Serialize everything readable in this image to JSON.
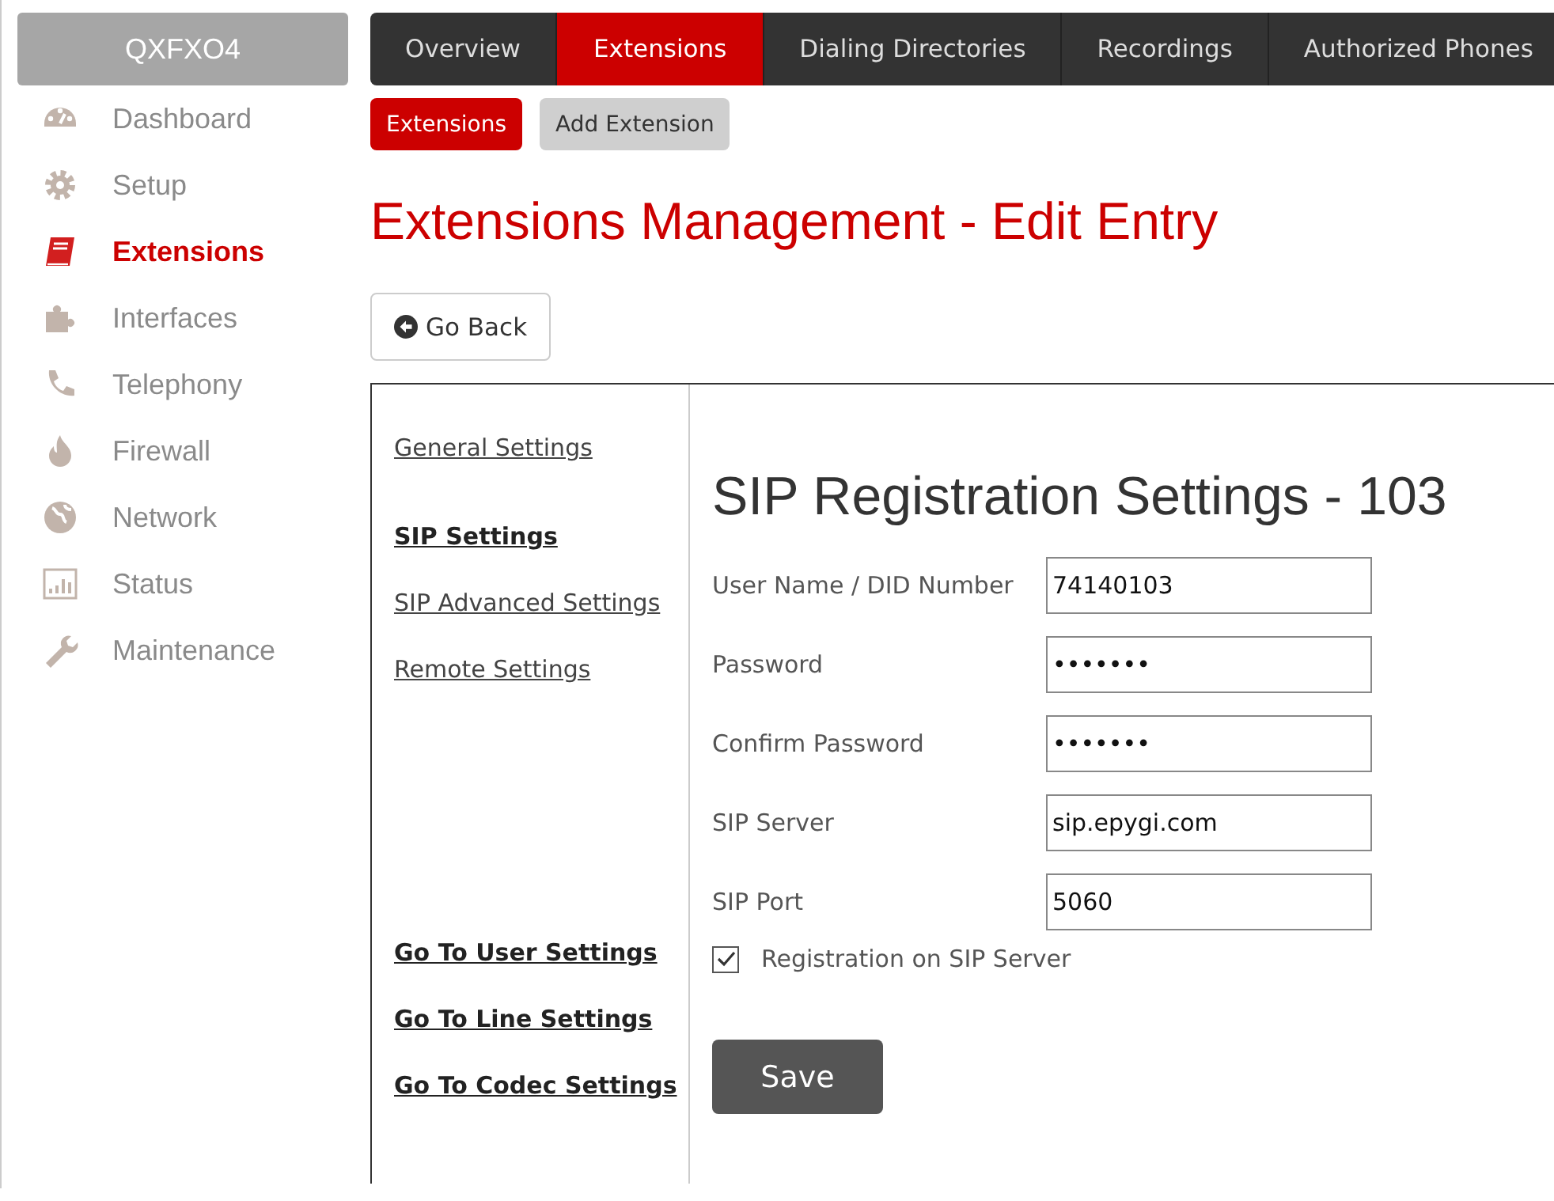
{
  "sidebar": {
    "title": "QXFXO4",
    "items": [
      {
        "label": "Dashboard",
        "selected": false
      },
      {
        "label": "Setup",
        "selected": false
      },
      {
        "label": "Extensions",
        "selected": true
      },
      {
        "label": "Interfaces",
        "selected": false
      },
      {
        "label": "Telephony",
        "selected": false
      },
      {
        "label": "Firewall",
        "selected": false
      },
      {
        "label": "Network",
        "selected": false
      },
      {
        "label": "Status",
        "selected": false
      },
      {
        "label": "Maintenance",
        "selected": false
      }
    ]
  },
  "tabs": [
    {
      "label": "Overview",
      "selected": false
    },
    {
      "label": "Extensions",
      "selected": true
    },
    {
      "label": "Dialing Directories",
      "selected": false
    },
    {
      "label": "Recordings",
      "selected": false
    },
    {
      "label": "Authorized Phones",
      "selected": false
    }
  ],
  "subtabs": [
    {
      "label": "Extensions",
      "selected": true
    },
    {
      "label": "Add Extension",
      "selected": false
    }
  ],
  "page_title": "Extensions Management - Edit Entry",
  "back_button": "Go Back",
  "settings_nav": {
    "items": [
      {
        "label": "General Settings",
        "selected": false
      },
      {
        "label": "SIP Settings",
        "selected": true
      },
      {
        "label": "SIP Advanced Settings",
        "selected": false
      },
      {
        "label": "Remote Settings",
        "selected": false
      }
    ],
    "shortcuts": [
      "Go To User Settings",
      "Go To Line Settings",
      "Go To Codec Settings"
    ]
  },
  "form": {
    "title": "SIP Registration Settings - 103",
    "fields": [
      {
        "label": "User Name / DID Number",
        "value": "74140103"
      },
      {
        "label": "Password",
        "value": "•••••••"
      },
      {
        "label": "Confirm Password",
        "value": "•••••••"
      },
      {
        "label": "SIP Server",
        "value": "sip.epygi.com"
      },
      {
        "label": "SIP Port",
        "value": "5060"
      }
    ],
    "registration": {
      "label": "Registration on SIP Server",
      "checked": true
    },
    "save_button": "Save"
  }
}
